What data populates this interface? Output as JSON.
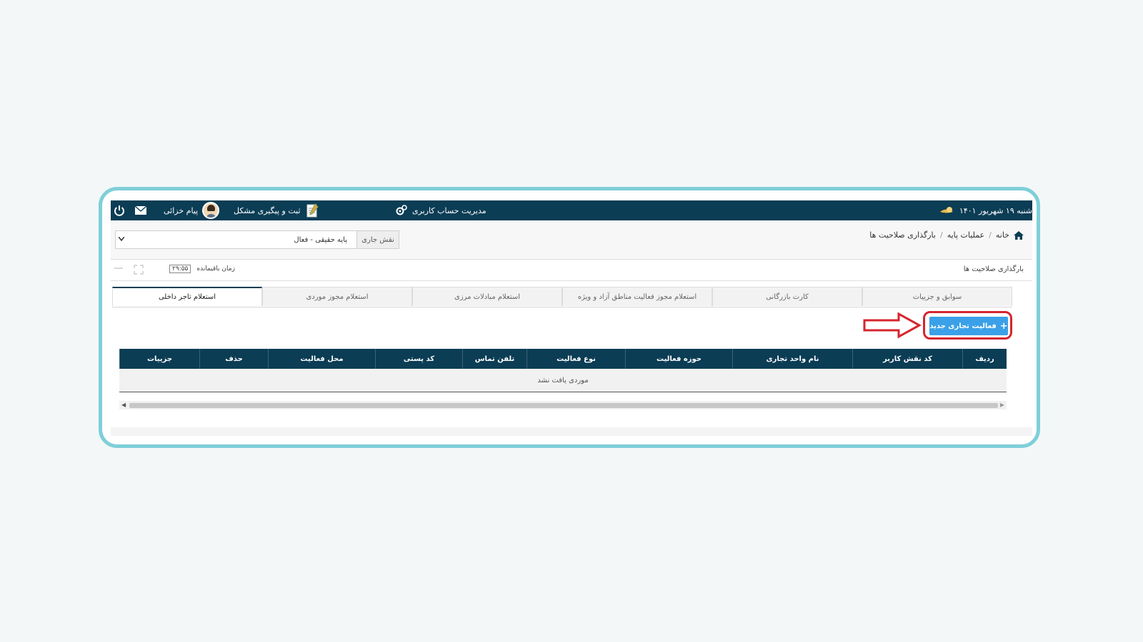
{
  "header": {
    "date": "شنبه ۱۹ شهریور ۱۴۰۱",
    "account_mgmt": "مدیریت حساب کاربری",
    "issue_tracking": "ثبت و پیگیری مشکل",
    "user_name": "پیام خزائی"
  },
  "breadcrumb": {
    "home": "خانه",
    "ops": "عملیات پایه",
    "page": "بارگذاری صلاحیت ها",
    "sep": "/"
  },
  "role": {
    "label": "نقش جاری",
    "value": "پایه حقیقی - فعال"
  },
  "panel": {
    "title": "بارگذاری صلاحیت ها",
    "time_label": "زمان باقیمانده",
    "time_value": "۲۹:۵۵"
  },
  "tabs": [
    {
      "label": "سوابق و جزییات"
    },
    {
      "label": "کارت بازرگانی"
    },
    {
      "label": "استعلام مجوز فعالیت مناطق آزاد و ویژه"
    },
    {
      "label": "استعلام مبادلات مرزی"
    },
    {
      "label": "استعلام مجوز موردی"
    },
    {
      "label": "استعلام تاجر داخلی"
    }
  ],
  "new_button": {
    "label": "فعالیت تجاری جدید",
    "icon": "+"
  },
  "table": {
    "columns": [
      "ردیف",
      "کد نقش کاربر",
      "نام واحد تجاری",
      "حوزه فعالیت",
      "نوع فعالیت",
      "تلفن تماس",
      "کد پستی",
      "محل فعالیت",
      "حذف",
      "جزییات"
    ],
    "empty_text": "موردی یافت نشد"
  },
  "colors": {
    "header_bg": "#0b3d55",
    "accent_button": "#3aa0e8",
    "highlight": "#d5252e",
    "frame": "#7ecfd9"
  }
}
